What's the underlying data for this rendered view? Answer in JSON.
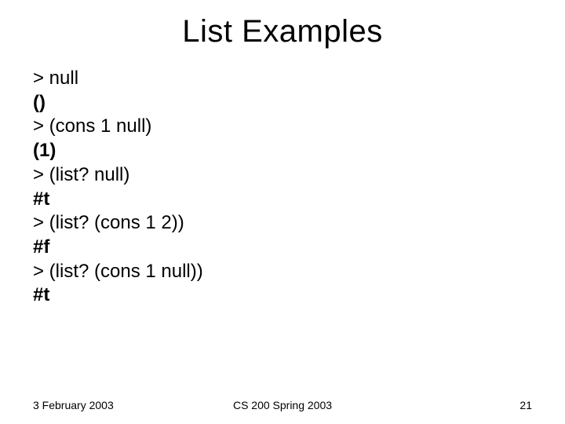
{
  "title": "List Examples",
  "lines": {
    "l1": "> null",
    "l2": "()",
    "l3": "> (cons 1 null)",
    "l4": "(1)",
    "l5": "> (list? null)",
    "l6": "#t",
    "l7": "> (list? (cons 1 2))",
    "l8": "#f",
    "l9": "> (list? (cons 1 null))",
    "l10": "#t"
  },
  "footer": {
    "date": "3 February 2003",
    "course": "CS 200 Spring 2003",
    "page": "21"
  }
}
